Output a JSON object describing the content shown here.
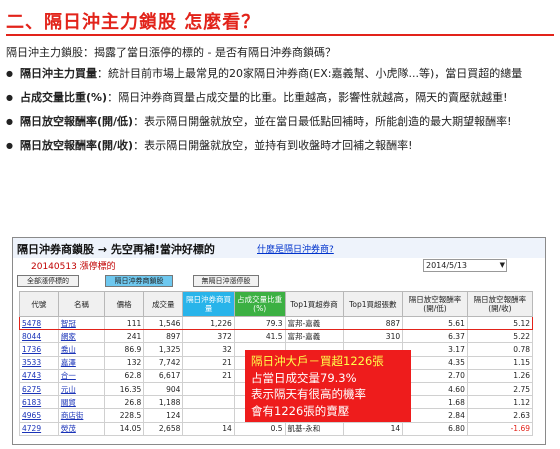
{
  "heading": "二、隔日沖主力鎖股 怎麼看？",
  "intro": "隔日沖主力鎖股：揭露了當日漲停的標的 - 是否有隔日沖券商鎖碼？",
  "bullets": [
    {
      "term": "隔日沖主力買量",
      "text": "：統計目前市場上最常見的20家隔日沖券商(EX:嘉義幫、小虎隊...等)，當日買超的總量"
    },
    {
      "term": "占成交量比重(%)",
      "text": "：隔日沖券商買量占成交量的比重。比重越高，影響性就越高，隔天的賣壓就越重!"
    },
    {
      "term": "隔日放空報酬率(開/低)",
      "text": "：表示隔日開盤就放空，並在當日最低點回補時，所能創造的最大期望報酬率!"
    },
    {
      "term": "隔日放空報酬率(開/收)",
      "text": "：表示隔日開盤就放空，並持有到收盤時才回補之報酬率!"
    }
  ],
  "panel": {
    "title": "隔日沖券商鎖股 → 先空再補!當沖好標的",
    "link": "什麼是隔日沖券商?",
    "date_label": "20140513 漲停標的",
    "date_select": "2014/5/13",
    "tabs": [
      "全部漲停標的",
      "隔日沖券商鎖股",
      "無隔日沖漲停股"
    ],
    "headers": [
      "代號",
      "名稱",
      "價格",
      "成交量",
      "隔日沖券商買量",
      "占成交量比重(%)",
      "Top1買超券商",
      "Top1買超張數",
      "隔日放空報酬率(開/低)",
      "隔日放空報酬率(開/收)"
    ],
    "rows": [
      [
        "5478",
        "智冠",
        "111",
        "1,546",
        "1,226",
        "79.3",
        "富邦-嘉義",
        "887",
        "5.61",
        "5.12"
      ],
      [
        "8044",
        "網家",
        "241",
        "897",
        "372",
        "41.5",
        "富邦-嘉義",
        "310",
        "6.37",
        "5.22"
      ],
      [
        "1736",
        "喬山",
        "86.9",
        "1,325",
        "32",
        "",
        "",
        "",
        "3.17",
        "0.78"
      ],
      [
        "3533",
        "嘉澤",
        "132",
        "7,742",
        "21",
        "",
        "",
        "",
        "4.35",
        "1.15"
      ],
      [
        "4743",
        "合一",
        "62.8",
        "6,617",
        "21",
        "",
        "",
        "",
        "2.70",
        "1.26"
      ],
      [
        "6275",
        "元山",
        "16.35",
        "904",
        "",
        "",
        "",
        "",
        "4.60",
        "2.75"
      ],
      [
        "6183",
        "關貿",
        "26.8",
        "1,188",
        "",
        "",
        "",
        "",
        "1.68",
        "1.12"
      ],
      [
        "4965",
        "商店街",
        "228.5",
        "124",
        "",
        "",
        "",
        "",
        "2.84",
        "2.63"
      ],
      [
        "4729",
        "熒茂",
        "14.05",
        "2,658",
        "14",
        "0.5",
        "凱基-永和",
        "14",
        "6.80",
        "-1.69"
      ]
    ]
  },
  "callout": {
    "line1": "隔日沖大戶－買超1226張",
    "line2": "占當日成交量79.3%",
    "line3": "表示隔天有很高的機率",
    "line4": "會有1226張的賣壓"
  }
}
